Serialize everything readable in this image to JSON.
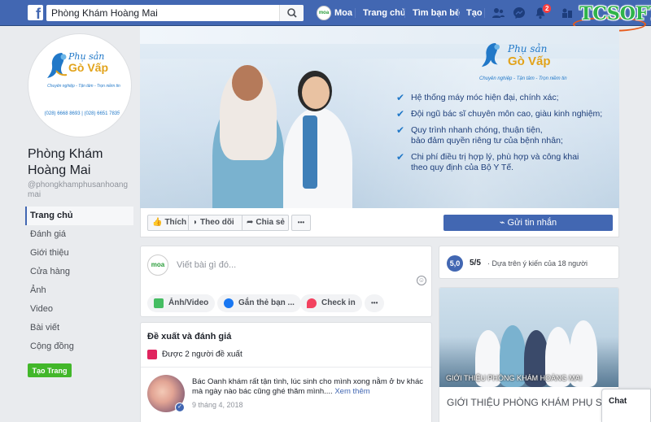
{
  "topbar": {
    "search_value": "Phòng Khám Hoàng Mai",
    "profile_name": "Moa",
    "profile_avatar_text": "moa",
    "nav": [
      "Trang chủ",
      "Tìm bạn bè",
      "Tạo"
    ],
    "notification_count": "2",
    "watermark": "TCSOFT"
  },
  "logo": {
    "line1": "Phụ sản",
    "line2": "Gò Vấp",
    "slogan": "Chuyên nghiệp - Tận tâm - Trọn niềm tin",
    "phone": "(028) 6668 8693 | (028) 6651 7835"
  },
  "page": {
    "name": "Phòng Khám Hoàng Mai",
    "username": "@phongkhamphusanhoangmai"
  },
  "sidebar": {
    "items": [
      "Trang chủ",
      "Đánh giá",
      "Giới thiệu",
      "Cửa hàng",
      "Ảnh",
      "Video",
      "Bài viết",
      "Cộng đồng"
    ],
    "create_page": "Tạo Trang"
  },
  "cover": {
    "bullets": [
      "Hệ thống máy móc hiện đại, chính xác;",
      "Đội ngũ bác sĩ chuyên môn cao, giàu kinh nghiệm;",
      "Quy trình nhanh chóng, thuận tiện,\nbảo đảm quyền riêng tư của bệnh nhân;",
      "Chi phí điều trị hợp lý, phù hợp và công khai\ntheo quy định của Bộ Y Tế."
    ]
  },
  "actions": {
    "like": "Thích",
    "follow": "Theo dõi",
    "share": "Chia sẻ",
    "more": "•••",
    "send_message": "Gửi tin nhắn"
  },
  "composer": {
    "placeholder": "Viết bài gì đó...",
    "chips": [
      "Ảnh/Video",
      "Gắn thẻ bạn ...",
      "Check in"
    ],
    "more": "•••"
  },
  "reviews": {
    "title": "Đề xuất và đánh giá",
    "recommend_count": "Được 2 người đề xuất",
    "review_text": "Bác Oanh khám rất tận tình, lúc sinh cho mình xong nằm ở bv khác mà ngày nào bác cũng ghé thăm mình....",
    "see_more": "Xem thêm",
    "date": "9 tháng 4, 2018"
  },
  "rating": {
    "badge": "5,0",
    "score": "5/5",
    "summary": "Dựa trên ý kiến của 18 người"
  },
  "video": {
    "caption": "GIỚI THIỆU PHÒNG KHÁM HOÀNG MAI",
    "title": "GIỚI THIỆU PHÒNG KHÁM PHỤ SẢN HOÀNG MAI"
  },
  "chat": {
    "label": "Chat"
  },
  "colors": {
    "brand_blue": "#4267b2",
    "green_button": "#42b72a",
    "logo_blue": "#2178c8",
    "logo_gold": "#e2a31b"
  }
}
